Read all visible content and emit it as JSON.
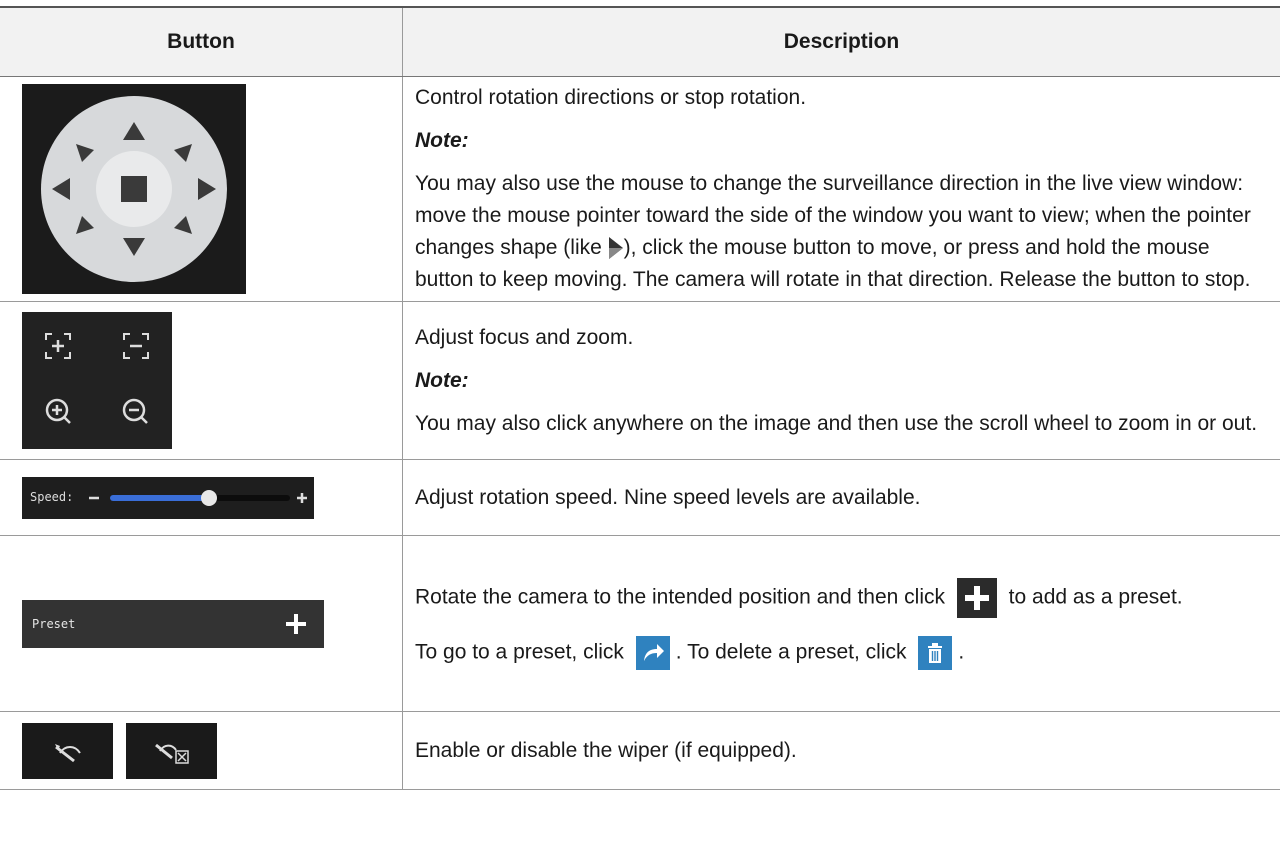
{
  "table": {
    "header_button": "Button",
    "header_description": "Description"
  },
  "rows": {
    "direction": {
      "line1": "Control rotation directions or stop rotation.",
      "note": "Note:",
      "text_a": "You may also use the mouse to change the surveillance direction in the live view window: move the mouse pointer toward the side of the window you want to view; when the pointer changes shape (like ",
      "text_b": "), click the mouse button to move, or press and hold the mouse button to keep moving. The camera will rotate in that direction. Release the button to stop."
    },
    "focus": {
      "line1": "Adjust focus and zoom.",
      "note": "Note:",
      "text": "You may also click anywhere on the image and then use the scroll wheel to zoom in or out."
    },
    "speed": {
      "line1": "Adjust rotation speed. Nine speed levels are available.",
      "label": "Speed:",
      "level": 0.55
    },
    "preset": {
      "text_a": "Rotate the camera to the intended position and then click ",
      "text_b": " to add as a preset.",
      "text_c": "To go to a preset, click ",
      "text_d": ". To delete a preset, click ",
      "text_e": ".",
      "label": "Preset"
    },
    "wiper": {
      "line1": "Enable or disable the wiper (if equipped)."
    }
  },
  "icons": {
    "ptz": "ptz-direction-pad-icon",
    "focus_near": "focus-near-icon",
    "focus_far": "focus-far-icon",
    "zoom_in": "zoom-in-icon",
    "zoom_out": "zoom-out-icon",
    "pointer": "pointer-arrow-icon",
    "add": "plus-icon",
    "goto": "go-to-preset-icon",
    "delete": "trash-icon",
    "wiper_on": "wiper-enable-icon",
    "wiper_off": "wiper-disable-icon"
  },
  "colors": {
    "accent_blue": "#2f82bf",
    "panel_dark": "#1b1b1b",
    "slider_blue": "#3a6ed8"
  }
}
